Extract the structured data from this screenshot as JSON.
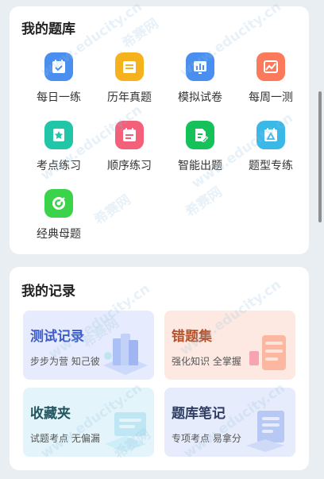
{
  "question_bank": {
    "title": "我的题库",
    "items": [
      {
        "label": "每日一练",
        "icon": "calendar-check-icon",
        "color": "#4a8ff0"
      },
      {
        "label": "历年真题",
        "icon": "document-list-icon",
        "color": "#f6b21d"
      },
      {
        "label": "模拟试卷",
        "icon": "bar-chart-icon",
        "color": "#4a8ff0"
      },
      {
        "label": "每周一测",
        "icon": "trend-line-icon",
        "color": "#fb7a5c"
      },
      {
        "label": "考点练习",
        "icon": "star-badge-icon",
        "color": "#21c6a8"
      },
      {
        "label": "顺序练习",
        "icon": "list-calendar-icon",
        "color": "#f2607a"
      },
      {
        "label": "智能出题",
        "icon": "smart-pen-icon",
        "color": "#15c25a"
      },
      {
        "label": "题型专练",
        "icon": "triangle-calendar-icon",
        "color": "#3ab8e8"
      },
      {
        "label": "经典母题",
        "icon": "target-icon",
        "color": "#3bd34a"
      }
    ]
  },
  "records": {
    "title": "我的记录",
    "cards": [
      {
        "title": "测试记录",
        "subtitle": "步步为营 知己彼",
        "title_color": "#3d5cc9",
        "bg": "#e6ecfd",
        "icon": "test-record-icon"
      },
      {
        "title": "错题集",
        "subtitle": "强化知识 全掌握",
        "title_color": "#b5532c",
        "bg": "#fde9e2",
        "icon": "wrong-questions-icon"
      },
      {
        "title": "收藏夹",
        "subtitle": "试题考点 无偏漏",
        "title_color": "#22555e",
        "bg": "#e3f5fb",
        "icon": "favorites-icon"
      },
      {
        "title": "题库笔记",
        "subtitle": "专项考点 易拿分",
        "title_color": "#2f3d63",
        "bg": "#e6ecfb",
        "icon": "notes-icon"
      }
    ]
  },
  "watermark": {
    "text_cn": "希赛网",
    "text_url": "www.educity.cn"
  }
}
